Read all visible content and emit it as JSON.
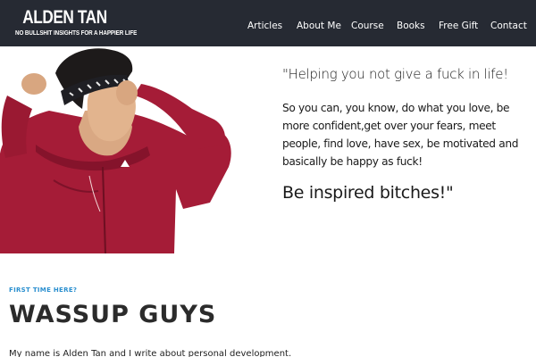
{
  "header": {
    "brand_title": "ALDEN TAN",
    "brand_tagline": "NO BULLSHIT INSIGHTS FOR A HAPPIER LIFE",
    "nav": [
      "Articles",
      "About Me",
      "Course",
      "Books",
      "Free Gift",
      "Contact"
    ]
  },
  "hero": {
    "headline": "\"Helping you not give a fuck in life!",
    "body": "So you can, you know, do what you love, be more confident,get over your fears, meet people, find love, have sex, be motivated and basically be happy as fuck!",
    "closing": "Be inspired bitches!\""
  },
  "intro": {
    "eyebrow": "FIRST TIME HERE?",
    "title": "WASSUP GUYS",
    "text": "My name is Alden Tan and I write about personal development."
  },
  "colors": {
    "header_bg": "#262a33",
    "accent": "#2a8fcf",
    "hoodie": "#a51c37"
  }
}
